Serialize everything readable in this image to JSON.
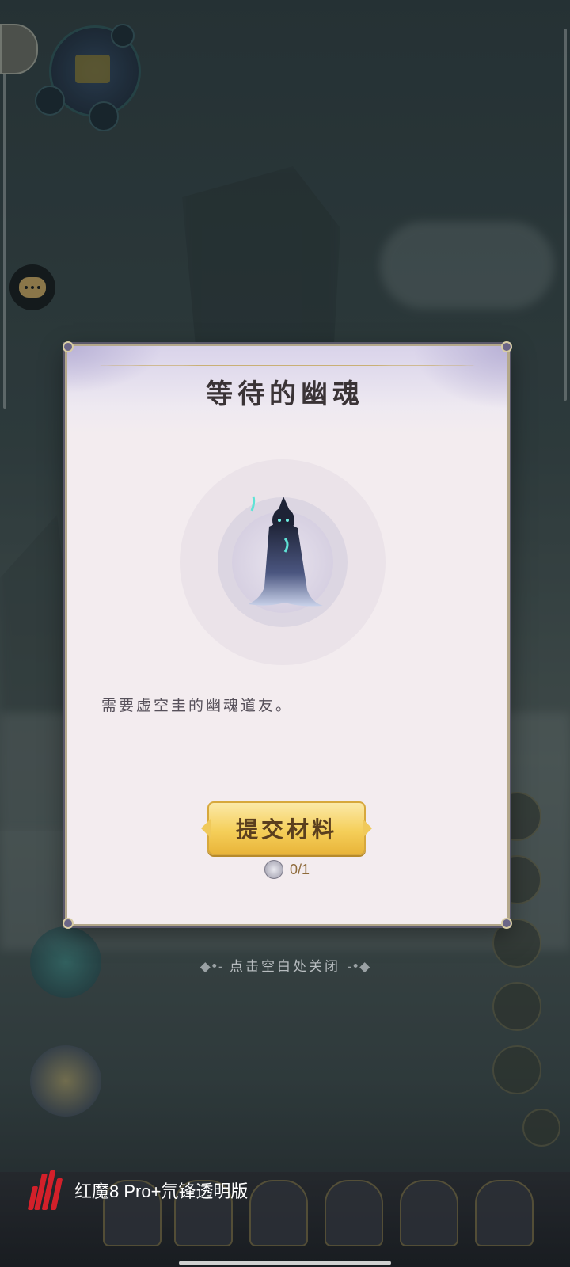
{
  "dialog": {
    "title": "等待的幽魂",
    "description": "需要虚空圭的幽魂道友。",
    "submit_label": "提交材料",
    "material_count": "0/1"
  },
  "close_hint": {
    "left_ornament": "◆•-",
    "text": "点击空白处关闭",
    "right_ornament": "-•◆"
  },
  "watermark": {
    "text": "红魔8 Pro+氘锋透明版"
  },
  "colors": {
    "dialog_bg": "#f3ecef",
    "dialog_border": "#b4a88b",
    "button_gold": "#f5cf5a",
    "brand_red": "#d3202a"
  }
}
